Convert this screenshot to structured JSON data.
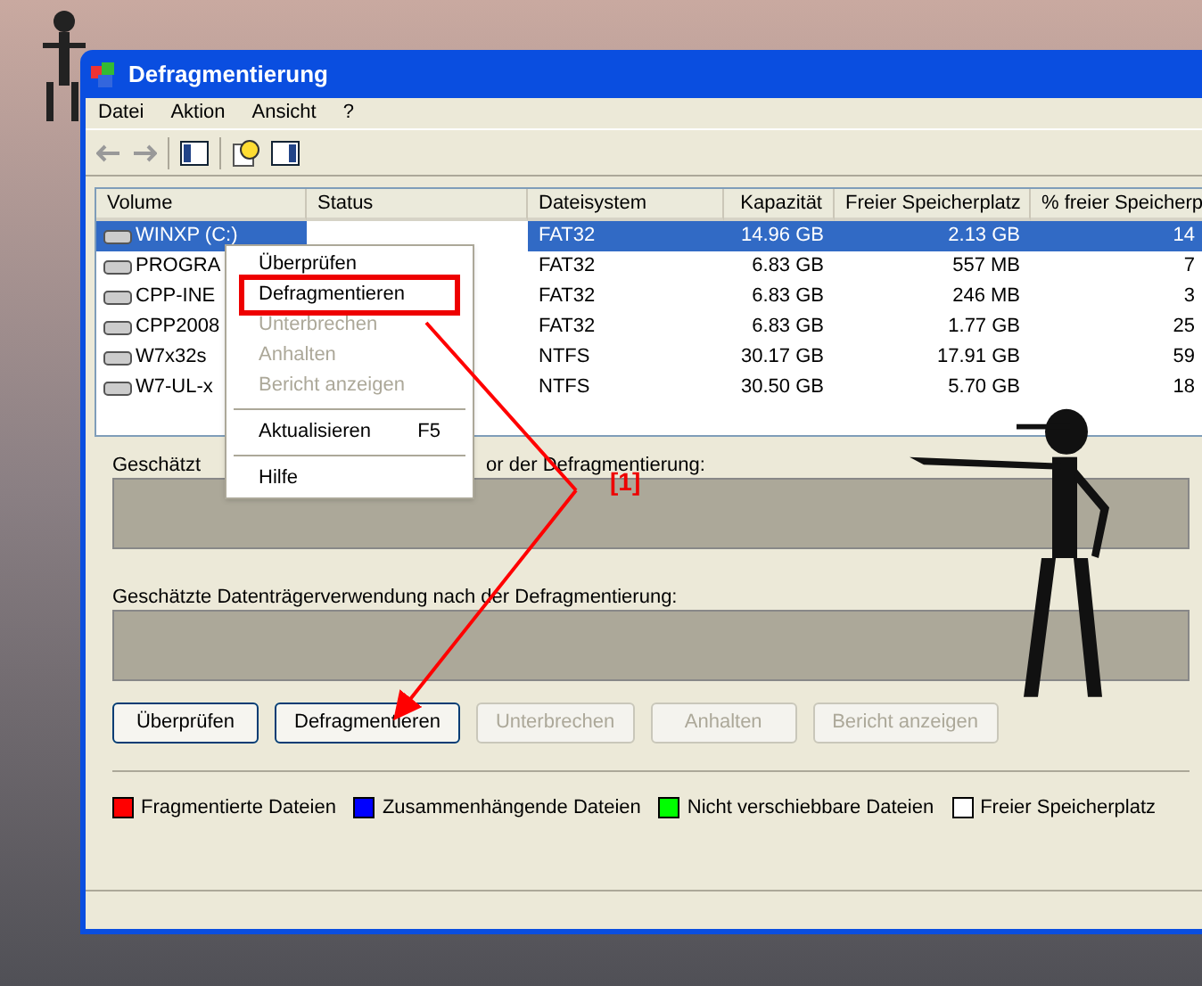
{
  "window": {
    "title": "Defragmentierung"
  },
  "menu": [
    "Datei",
    "Aktion",
    "Ansicht",
    "?"
  ],
  "table": {
    "columns": [
      "Volume",
      "Status",
      "Dateisystem",
      "Kapazität",
      "Freier Speicherplatz",
      "% freier Speicherp"
    ],
    "rows": [
      {
        "volume": "WINXP (C:)",
        "status": "",
        "fs": "FAT32",
        "capacity": "14.96 GB",
        "free": "2.13 GB",
        "pct": "14",
        "selected": true
      },
      {
        "volume": "PROGRA",
        "status": "",
        "fs": "FAT32",
        "capacity": "6.83 GB",
        "free": "557 MB",
        "pct": "7",
        "selected": false
      },
      {
        "volume": "CPP-INE",
        "status": "",
        "fs": "FAT32",
        "capacity": "6.83 GB",
        "free": "246 MB",
        "pct": "3",
        "selected": false
      },
      {
        "volume": "CPP2008",
        "status": "",
        "fs": "FAT32",
        "capacity": "6.83 GB",
        "free": "1.77 GB",
        "pct": "25",
        "selected": false
      },
      {
        "volume": "W7x32s",
        "status": "",
        "fs": "NTFS",
        "capacity": "30.17 GB",
        "free": "17.91 GB",
        "pct": "59",
        "selected": false
      },
      {
        "volume": "W7-UL-x",
        "status": "",
        "fs": "NTFS",
        "capacity": "30.50 GB",
        "free": "5.70 GB",
        "pct": "18",
        "selected": false
      }
    ]
  },
  "context_menu": [
    {
      "kind": "item",
      "label": "Überprüfen",
      "disabled": false,
      "highlighted": false
    },
    {
      "kind": "item",
      "label": "Defragmentieren",
      "disabled": false,
      "highlighted": true
    },
    {
      "kind": "item",
      "label": "Unterbrechen",
      "disabled": true,
      "highlighted": false
    },
    {
      "kind": "item",
      "label": "Anhalten",
      "disabled": true,
      "highlighted": false
    },
    {
      "kind": "item",
      "label": "Bericht anzeigen",
      "disabled": true,
      "highlighted": false
    },
    {
      "kind": "separator"
    },
    {
      "kind": "item",
      "label": "Aktualisieren",
      "shortcut": "F5",
      "disabled": false,
      "highlighted": false
    },
    {
      "kind": "separator"
    },
    {
      "kind": "item",
      "label": "Hilfe",
      "disabled": false,
      "highlighted": false
    }
  ],
  "before_label": [
    "Geschätzt",
    "or der Defragmentierung:"
  ],
  "after_label": "Geschätzte Datenträgerverwendung nach der Defragmentierung:",
  "buttons": [
    {
      "label": "Überprüfen",
      "disabled": false
    },
    {
      "label": "Defragmentieren",
      "disabled": false
    },
    {
      "label": "Unterbrechen",
      "disabled": true
    },
    {
      "label": "Anhalten",
      "disabled": true
    },
    {
      "label": "Bericht anzeigen",
      "disabled": true
    }
  ],
  "legend": [
    {
      "label": "Fragmentierte Dateien",
      "color": "#ff0000"
    },
    {
      "label": "Zusammenhängende Dateien",
      "color": "#0000ff"
    },
    {
      "label": "Nicht verschiebbare Dateien",
      "color": "#00ff00"
    },
    {
      "label": "Freier Speicherplatz",
      "color": "#ffffff"
    }
  ],
  "annotation": {
    "label": "[1]"
  }
}
